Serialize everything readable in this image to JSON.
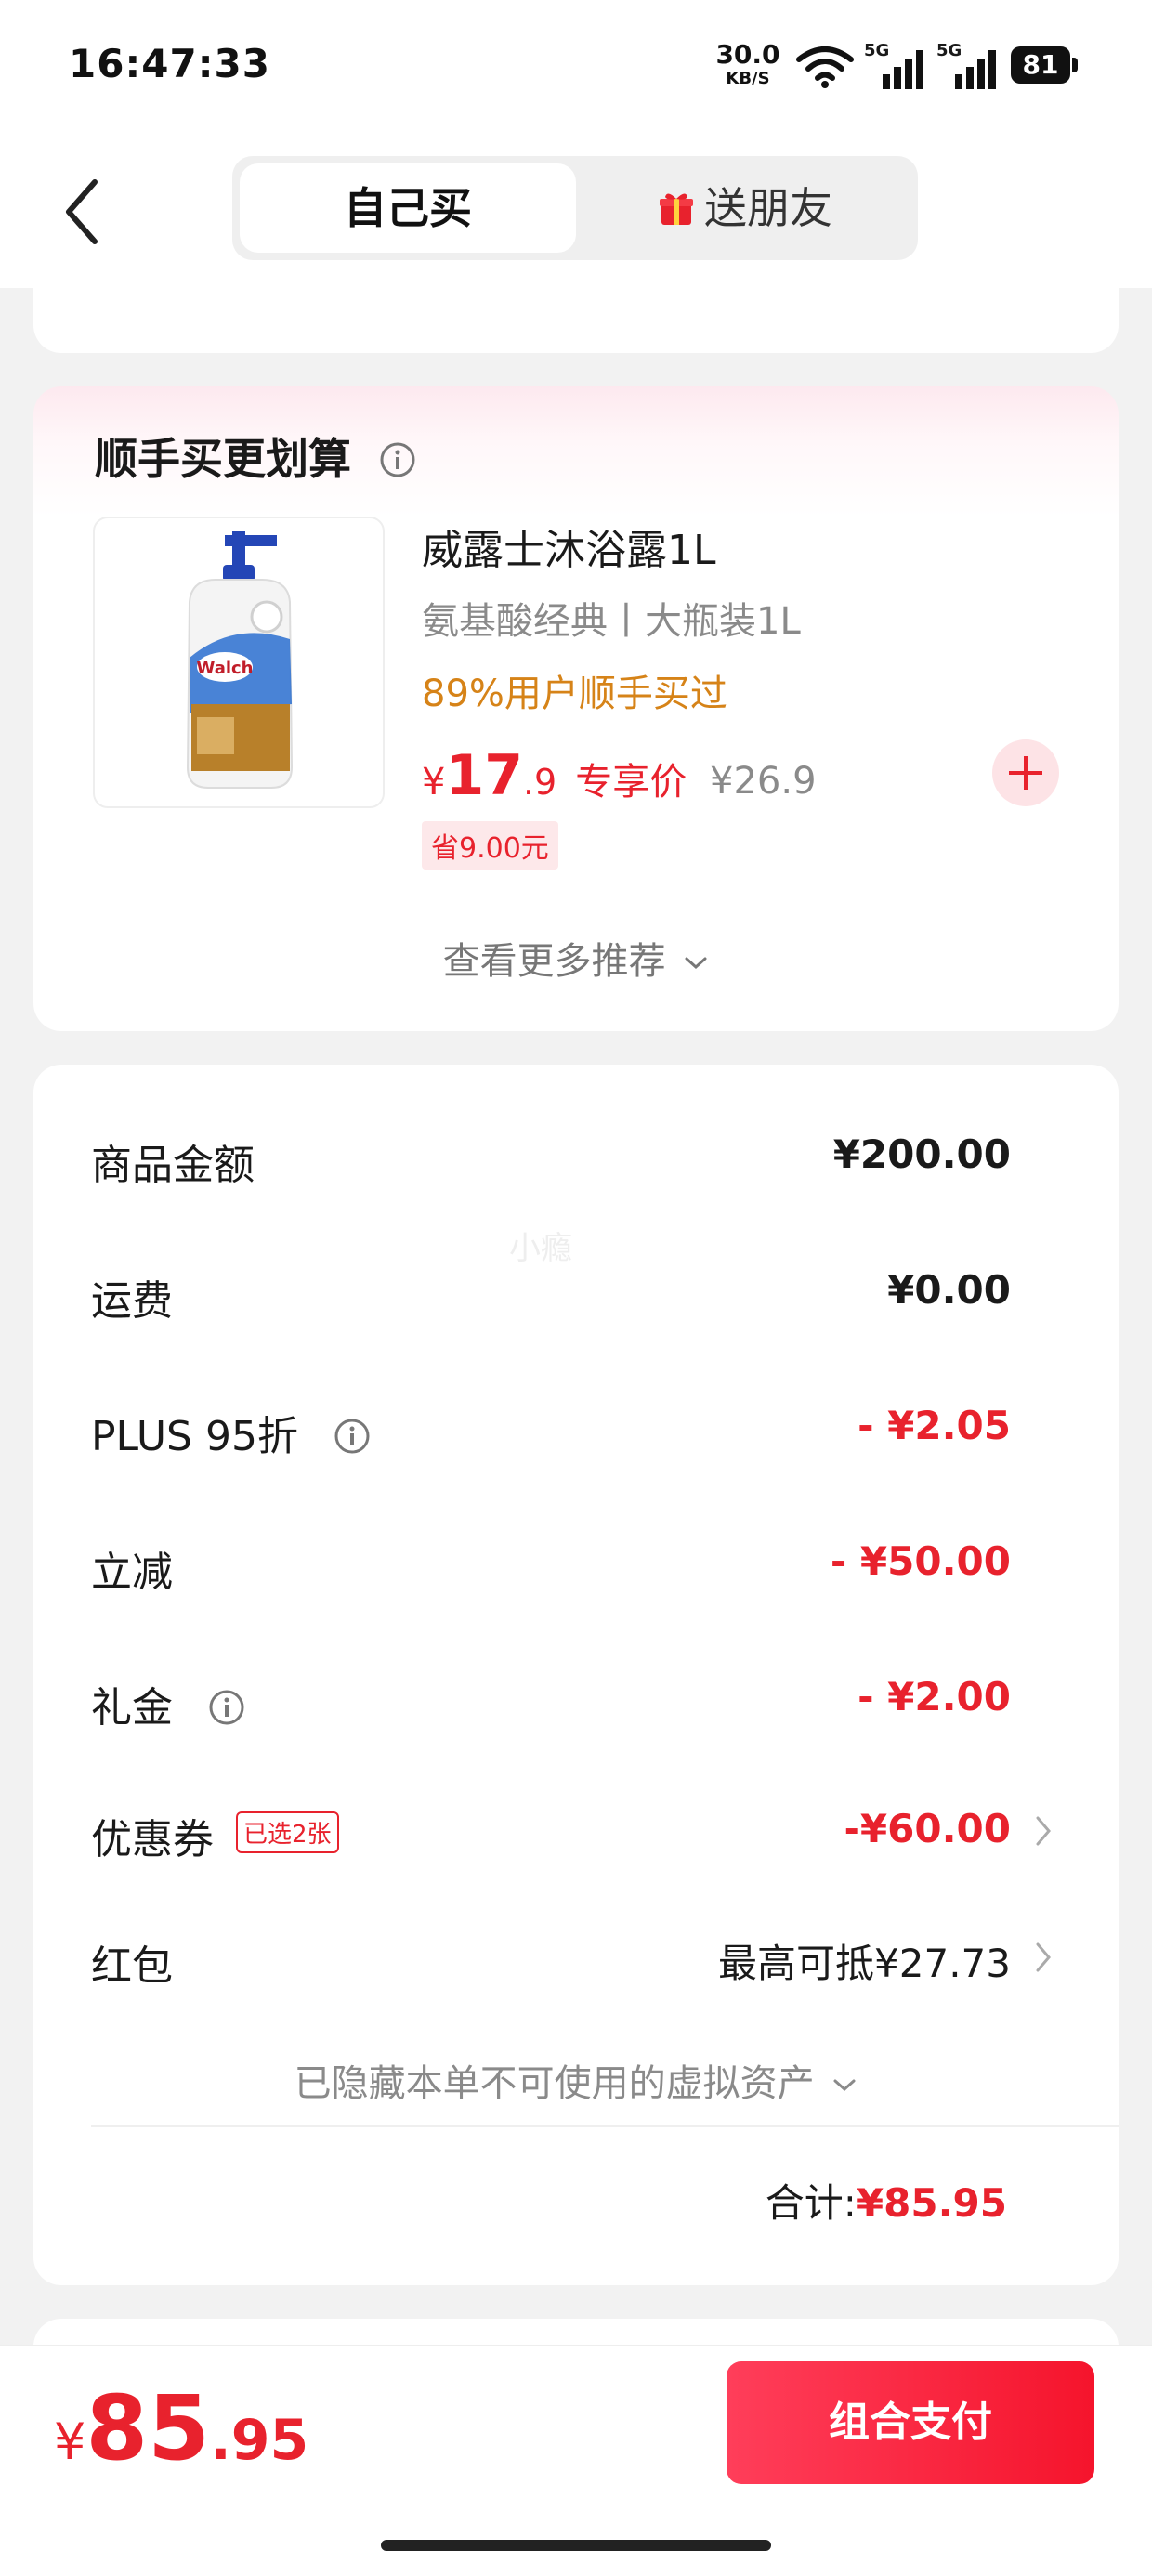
{
  "status_bar": {
    "time": "16:47:33",
    "net_speed_value": "30.0",
    "net_speed_unit": "KB/S",
    "signal_1_label": "5G",
    "signal_2_label": "5G",
    "battery": "81"
  },
  "nav": {
    "tabs": [
      {
        "label": "自己买",
        "selected": true
      },
      {
        "label": "送朋友",
        "selected": false
      }
    ],
    "icons": {
      "back": "back-chevron-icon",
      "gift": "gift-icon"
    }
  },
  "recommend": {
    "title": "顺手买更划算",
    "product": {
      "name": "威露士沐浴露1L",
      "spec": "氨基酸经典丨大瓶装1L",
      "social_proof": "89%用户顺手买过",
      "currency": "¥",
      "price_int": "17",
      "price_dec": ".9",
      "price_tag": "专享价",
      "original_price": "¥26.9",
      "save_badge": "省9.00元",
      "image_brand": "Walch"
    },
    "more_label": "查看更多推荐"
  },
  "summary": {
    "rows": [
      {
        "label": "商品金额",
        "value": "¥200.00"
      },
      {
        "label": "运费",
        "value": "¥0.00"
      },
      {
        "label": "PLUS 95折",
        "value": "- ¥2.05"
      },
      {
        "label": "立减",
        "value": "- ¥50.00"
      },
      {
        "label": "礼金",
        "value": "- ¥2.00"
      },
      {
        "label": "优惠券",
        "value": "-¥60.00",
        "badge": "已选2张"
      },
      {
        "label": "红包",
        "value": "最高可抵¥27.73"
      }
    ],
    "hidden_assets": "已隐藏本单不可使用的虚拟资产",
    "total_label": "合计:",
    "total_value": "¥85.95",
    "watermark": "小瘾"
  },
  "bottom_bar": {
    "currency": "¥",
    "total_int": "85",
    "total_dec": ".95",
    "pay_button": "组合支付"
  },
  "colors": {
    "accent_red": "#e8222d",
    "social_orange": "#d68318",
    "page_bg": "#f2f2f2"
  }
}
